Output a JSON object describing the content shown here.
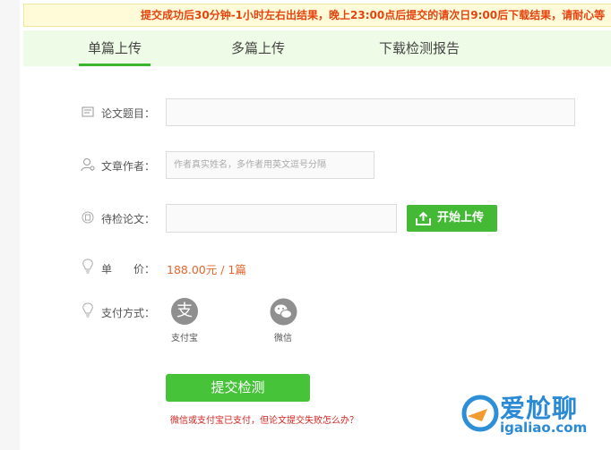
{
  "notice": "提交成功后30分钟-1小时左右出结果，晚上23:00点后提交的请次日9:00后下载结果，请耐心等",
  "tabs": [
    {
      "label": "单篇上传",
      "active": true
    },
    {
      "label": "多篇上传",
      "active": false
    },
    {
      "label": "下载检测报告",
      "active": false
    }
  ],
  "form": {
    "title_label": "论文题目：",
    "author_label": "文章作者：",
    "author_placeholder": "作者真实姓名，多作者用英文逗号分隔",
    "paper_label": "待检论文：",
    "upload_button": "开始上传",
    "price_label": "单　　价：",
    "price_value": "188.00元 / 1篇",
    "payment_label": "支付方式：",
    "payment_options": [
      {
        "label": "支付宝",
        "icon": "alipay-icon",
        "glyph": "支"
      },
      {
        "label": "微信",
        "icon": "wechat-icon"
      }
    ],
    "submit_button": "提交检测",
    "help_link": "微信或支付宝已支付，但论文提交失败怎么办？"
  },
  "watermark": {
    "text_1": "爱尬聊",
    "text_2": "igaliao.com"
  },
  "colors": {
    "accent_green": "#43b936",
    "notice_red": "#e4440f",
    "price_orange": "#e7652c",
    "link_red": "#d2231e"
  }
}
